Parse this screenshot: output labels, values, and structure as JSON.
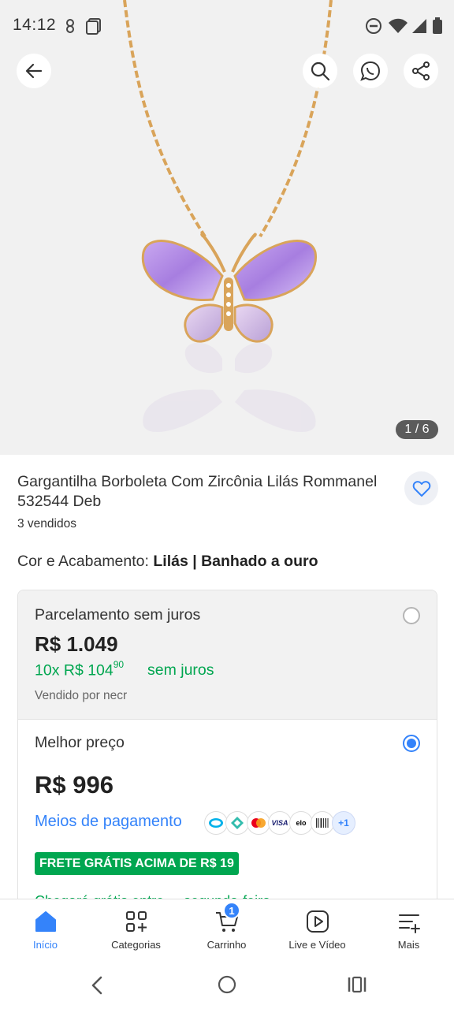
{
  "status_bar": {
    "time": "14:12"
  },
  "gallery": {
    "counter": "1 / 6"
  },
  "product": {
    "title": "Gargantilha Borboleta Com Zircônia Lilás Rommanel 532544 Deb",
    "sold": "3 vendidos",
    "variant_label": "Cor e Acabamento:",
    "variant_value": "Lilás | Banhado a ouro"
  },
  "payment": {
    "option1": {
      "heading": "Parcelamento sem juros",
      "price": "R$ 1.049",
      "installments": "10x R$ 104",
      "installments_cents": "90",
      "no_interest": "sem juros",
      "seller": "Vendido por necr"
    },
    "option2": {
      "heading": "Melhor preço",
      "price": "R$ 996",
      "methods_link": "Meios de pagamento",
      "methods": [
        "mercado-pago-icon",
        "pix-icon",
        "mastercard-icon",
        "visa-icon",
        "elo-icon",
        "boleto-icon"
      ],
      "visa": "VISA",
      "elo": "elo",
      "more_methods": "+1",
      "free_shipping": "FRETE GRÁTIS ACIMA DE R$ 19",
      "partial_text": "Chegará grátis entre ... segunda-feira"
    }
  },
  "bottom_nav": {
    "items": [
      {
        "label": "Início",
        "icon": "home-icon",
        "active": true
      },
      {
        "label": "Categorias",
        "icon": "categories-icon"
      },
      {
        "label": "Carrinho",
        "icon": "cart-icon",
        "badge": "1"
      },
      {
        "label": "Live e Vídeo",
        "icon": "play-icon"
      },
      {
        "label": "Mais",
        "icon": "menu-plus-icon"
      }
    ]
  },
  "colors": {
    "accent_blue": "#3483fa",
    "green": "#00a650",
    "gem_purple": "#b48ee6",
    "gold": "#d9a45a"
  }
}
